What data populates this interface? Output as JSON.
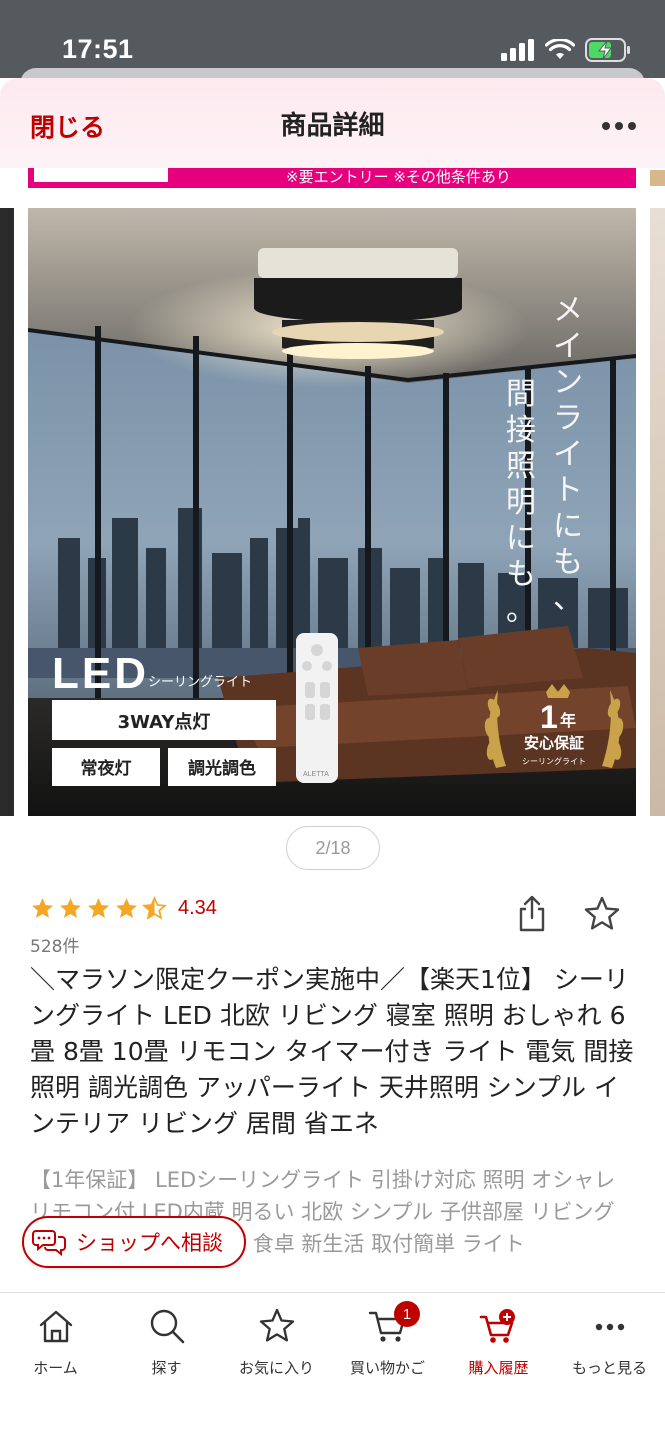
{
  "status_bar": {
    "time": "17:51"
  },
  "header": {
    "close_label": "閉じる",
    "title": "商品詳細"
  },
  "promo": {
    "text": "※要エントリー ※その他条件あり"
  },
  "carousel": {
    "page_indicator": "2/18",
    "image": {
      "headline_vertical_1": "メインライトにも、",
      "headline_vertical_2": "間接照明にも。",
      "led_label": "LED",
      "led_sub": "シーリングライト",
      "feature_main": "3WAY点灯",
      "feature_1": "常夜灯",
      "feature_2": "調光調色",
      "badge_year": "1",
      "badge_year_unit": "年",
      "badge_text": "安心保証",
      "badge_sub": "シーリングライト",
      "remote_brand": "ALETTA"
    }
  },
  "product": {
    "rating": 4.34,
    "rating_label": "4.34",
    "review_count": "528件",
    "title": "＼マラソン限定クーポン実施中／【楽天1位】 シーリングライト LED 北欧 リビング 寝室 照明 おしゃれ 6畳 8畳 10畳 リモコン タイマー付き ライト 電気 間接照明 調光調色 アッパーライト 天井照明 シンプル インテリア リビング  居間 省エネ",
    "subtitle": "【1年保証】 LEDシーリングライト 引掛け対応 照明 オシャレ リモコン付 LED内蔵 明るい 北欧 シンプル 子供部屋 リビング 寝室 シーリングランプ 食卓 新生活 取付簡単 ライト"
  },
  "chat_button": {
    "label": "ショップへ相談"
  },
  "tab_bar": {
    "tabs": [
      {
        "label": "ホーム",
        "icon": "home-icon"
      },
      {
        "label": "探す",
        "icon": "search-icon"
      },
      {
        "label": "お気に入り",
        "icon": "star-icon"
      },
      {
        "label": "買い物かご",
        "icon": "cart-icon",
        "badge": "1"
      },
      {
        "label": "購入履歴",
        "icon": "purchase-history-icon",
        "active": true
      },
      {
        "label": "もっと見る",
        "icon": "more-icon"
      }
    ]
  },
  "colors": {
    "accent": "#bf0000",
    "promo": "#e6007e",
    "star": "#f5a623"
  }
}
